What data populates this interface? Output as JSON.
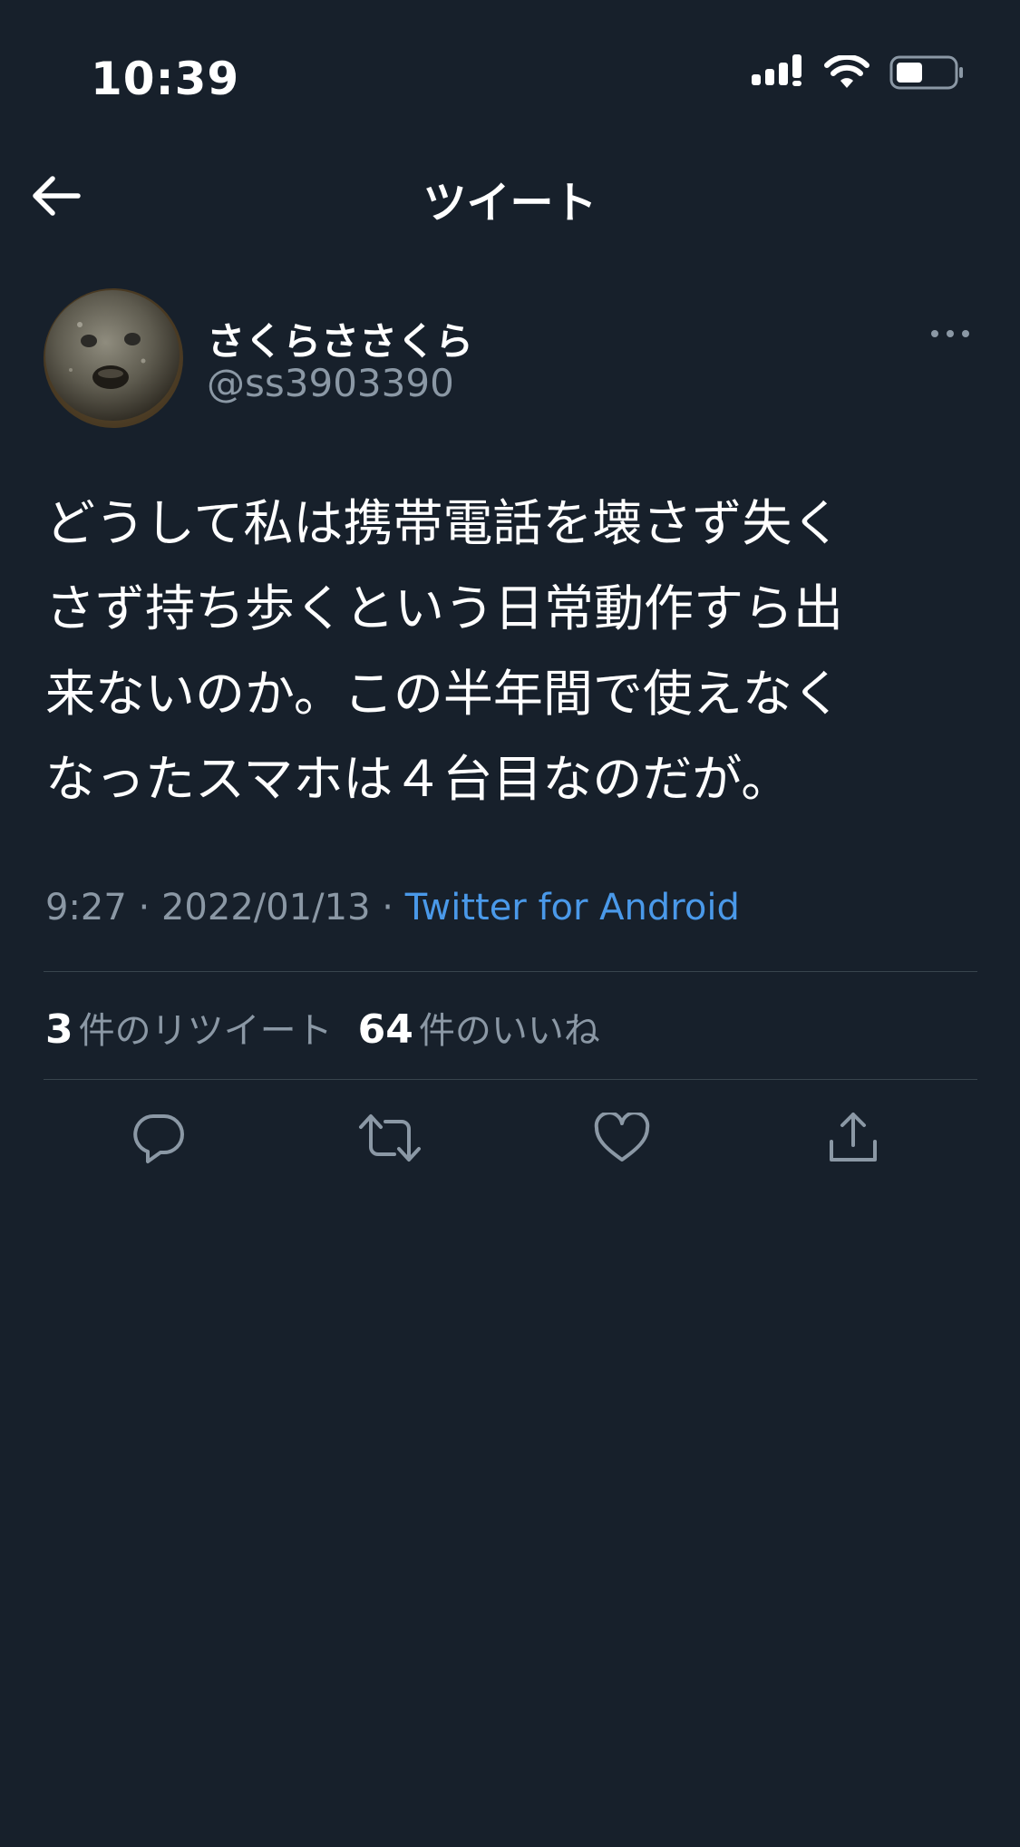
{
  "status_bar": {
    "time": "10:39"
  },
  "header": {
    "title": "ツイート"
  },
  "author": {
    "display_name": "さくらささくら",
    "handle": "@ss3903390"
  },
  "tweet": {
    "text": "どうして私は携帯電話を壊さず失く\nさず持ち歩くという日常動作すら出\n来ないのか。この半年間で使えなく\nなったスマホは４台目なのだが。",
    "time": "9:27",
    "date": "2022/01/13",
    "separator": "·",
    "source": "Twitter for Android"
  },
  "stats": {
    "retweet_count": "3",
    "retweet_label": "件のリツイート",
    "like_count": "64",
    "like_label": "件のいいね"
  },
  "actions": {
    "icons": [
      "reply-icon",
      "retweet-icon",
      "like-icon",
      "share-icon"
    ]
  },
  "colors": {
    "background": "#17202b",
    "secondary_text": "#8b98a5",
    "link": "#4a99e9",
    "divider": "#38444d"
  }
}
